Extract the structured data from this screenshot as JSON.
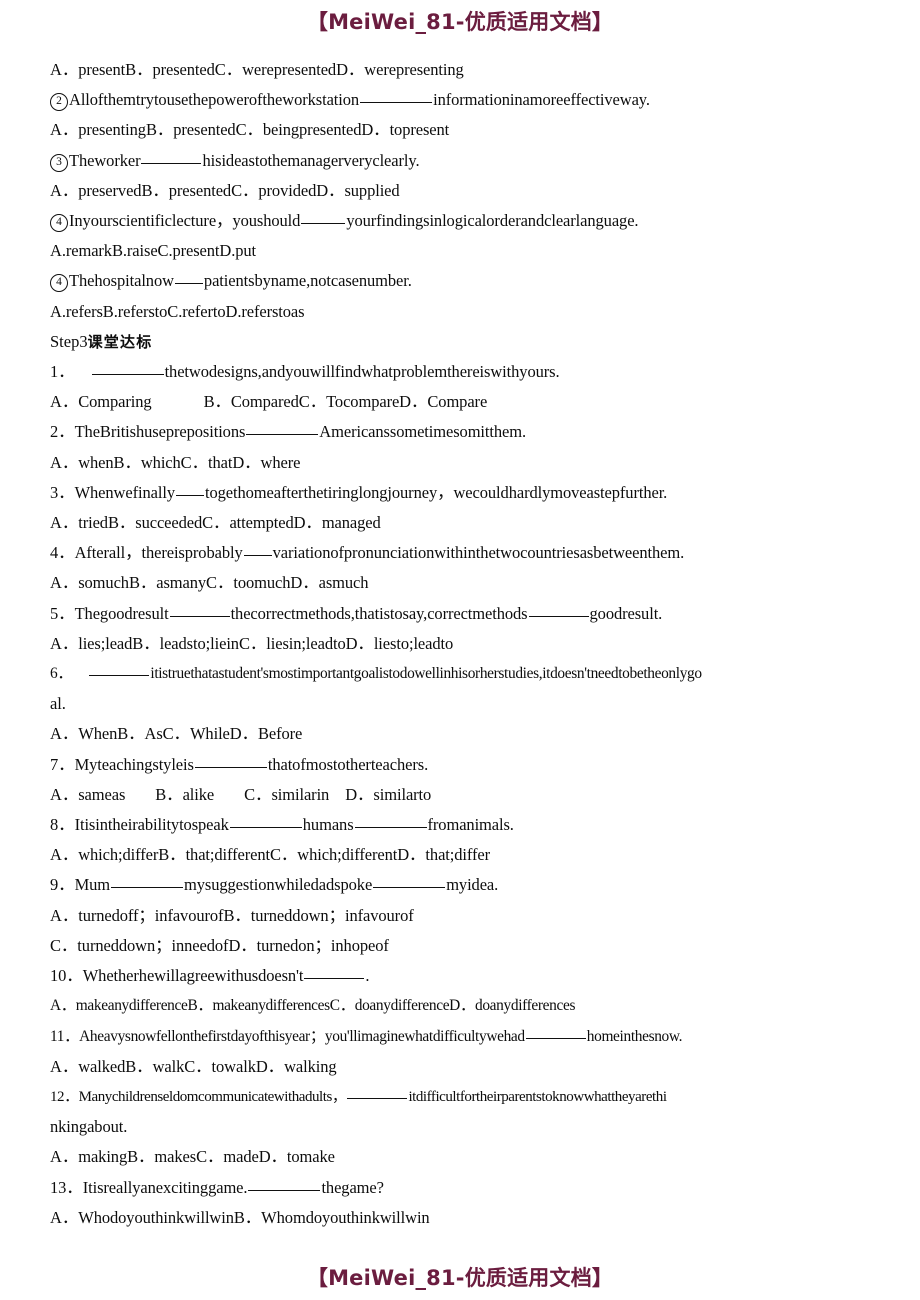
{
  "watermark": {
    "top": "【MeiWei_81-优质适用文档】",
    "bottom": "【MeiWei_81-优质适用文档】",
    "color": "#6b1d3f"
  },
  "document": {
    "text_color": "#0d0d0d",
    "background": "#ffffff"
  },
  "heading": {
    "latin": "Step3",
    "cjk": "课堂达标"
  },
  "lines": {
    "l1_options": "A．presentB．presentedC．werepresentedD．werepresenting",
    "l2_num": "2",
    "l2_a": "Allofthemtrytousethepoweroftheworkstation",
    "l2_b": "informationinamoreeffectiveway.",
    "l3_options": "A．presentingB．presentedC．beingpresentedD．topresent",
    "l4_num": "3",
    "l4_a": "Theworker",
    "l4_b": "hisideastothemanagerveryclearly.",
    "l5_options": "A．preservedB．presentedC．providedD．supplied",
    "l6_num": "4",
    "l6_a": "Inyourscientificlecture，youshould",
    "l6_b": "yourfindingsinlogicalorderandclearlanguage.",
    "l7_options": "A.remarkB.raiseC.presentD.put",
    "l8_num": "4",
    "l8_a": "Thehospitalnow",
    "l8_b": "patientsbyname,notcasenumber.",
    "l9_options": "A.refersB.referstoC.refertoD.referstoas",
    "q1_num": "1．",
    "q1_b": "thetwodesigns,andyouwillfindwhatproblemthereiswithyours.",
    "q1_optA": "A．Comparing",
    "q1_optBCD": "B．ComparedC．TocompareD．Compare",
    "q2_num": "2．",
    "q2_a": "TheBritishuseprepositions",
    "q2_b": "Americanssometimesomitthem.",
    "q2_opts": "A．whenB．whichC．thatD．where",
    "q3_num": "3．",
    "q3_a": "Whenwefinally",
    "q3_b": "togethomeafterthetiringlongjourney，wecouldhardlymoveastepfurther.",
    "q3_opts": "A．triedB．succeededC．attemptedD．managed",
    "q4_num": "4．",
    "q4_a": "Afterall，thereisprobably",
    "q4_b": "variationofpronunciationwithinthetwocountriesasbetweenthem.",
    "q4_opts": "A．somuchB．asmanyC．toomuchD．asmuch",
    "q5_num": "5．",
    "q5_a": "Thegoodresult",
    "q5_b": "thecorrectmethods,thatistosay,correctmethods",
    "q5_c": "goodresult.",
    "q5_opts": "A．lies;leadB．leadsto;lieinC．liesin;leadtoD．liesto;leadto",
    "q6_num": "6．",
    "q6_b": "itistruethatastudent'smostimportantgoalistodowellinhisorherstudies,itdoesn'tneedtobetheonlygo",
    "q6_wrap": "al.",
    "q6_opts": "A．WhenB．AsC．WhileD．Before",
    "q7_num": "7．",
    "q7_a": "Myteachingstyleis",
    "q7_b": "thatofmostotherteachers.",
    "q7_optA": "A．sameas",
    "q7_optB": "B．alike",
    "q7_optC": "C．similarin",
    "q7_optD": "D．similarto",
    "q8_num": "8．",
    "q8_a": "Itisintheirabilitytospeak",
    "q8_b": "humans",
    "q8_c": "fromanimals.",
    "q8_opts": "A．which;differB．that;differentC．which;differentD．that;differ",
    "q9_num": "9．",
    "q9_a": "Mum",
    "q9_b": "mysuggestionwhiledadspoke",
    "q9_c": "myidea.",
    "q9_optAB": "A．turnedoff；infavourofB．turneddown；infavourof",
    "q9_optCD": "C．turneddown；inneedofD．turnedon；inhopeof",
    "q10_num": "10．",
    "q10_a": "Whetherhewillagreewithusdoesn't",
    "q10_b": ".",
    "q10_opts": "A．makeanydifferenceB．makeanydifferencesC．doanydifferenceD．doanydifferences",
    "q11_num": "11．",
    "q11_a": "Aheavysnowfellonthefirstdayofthisyear；you'llimaginewhatdifficultywehad",
    "q11_b": "homeinthesnow.",
    "q11_opts": "A．walkedB．walkC．towalkD．walking",
    "q12_num": "12．",
    "q12_a": "Manychildrenseldomcommunicatewithadults，",
    "q12_b": "itdifficultfortheirparentstoknowwhattheyarethi",
    "q12_wrap": "nkingabout.",
    "q12_opts": "A．makingB．makesC．madeD．tomake",
    "q13_num": "13．",
    "q13_a": "Itisreallyanexcitinggame.",
    "q13_b": "thegame?",
    "q13_opts": "A．WhodoyouthinkwillwinB．Whomdoyouthinkwillwin"
  }
}
